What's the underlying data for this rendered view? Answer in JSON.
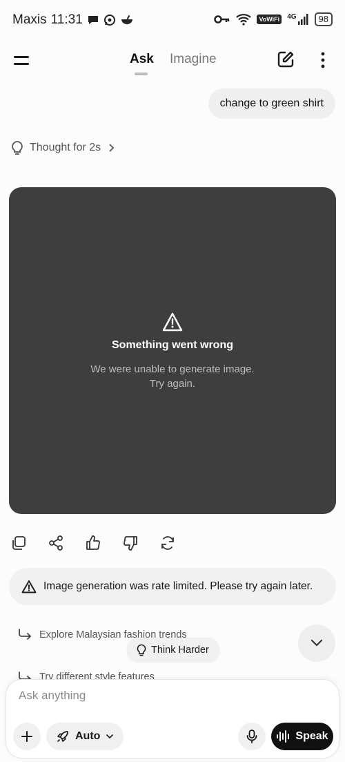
{
  "status_bar": {
    "carrier": "Maxis",
    "time": "11:31",
    "vowifi": "VoWiFi",
    "network": "4G",
    "battery": "98",
    "notification_icons": [
      "chat-bubble-icon",
      "whatsapp-icon",
      "bowl-icon"
    ],
    "system_icons": [
      "key-icon",
      "wifi-icon",
      "signal-icon",
      "battery-icon"
    ]
  },
  "header": {
    "tabs": [
      {
        "label": "Ask",
        "active": true
      },
      {
        "label": "Imagine",
        "active": false
      }
    ],
    "icons": [
      "menu-icon",
      "new-chat-icon",
      "more-vertical-icon"
    ]
  },
  "conversation": {
    "user_message": "change to green shirt",
    "thought_label": "Thought for 2s",
    "image_error": {
      "title": "Something went wrong",
      "message_line1": "We were unable to generate image.",
      "message_line2": "Try again."
    },
    "actions": [
      "copy-icon",
      "share-icon",
      "thumbs-up-icon",
      "thumbs-down-icon",
      "regenerate-icon"
    ],
    "notice": "Image generation was rate limited. Please try again later."
  },
  "suggestions": [
    {
      "label": "Explore Malaysian fashion trends"
    },
    {
      "label": "Try different style features"
    }
  ],
  "think_harder_label": "Think Harder",
  "composer": {
    "placeholder": "Ask anything",
    "mode_label": "Auto",
    "speak_label": "Speak"
  },
  "colors": {
    "background": "#fcfcfc",
    "image_card": "#3e3e3e",
    "speak_button": "#111111",
    "pill": "#f0f0f0"
  }
}
